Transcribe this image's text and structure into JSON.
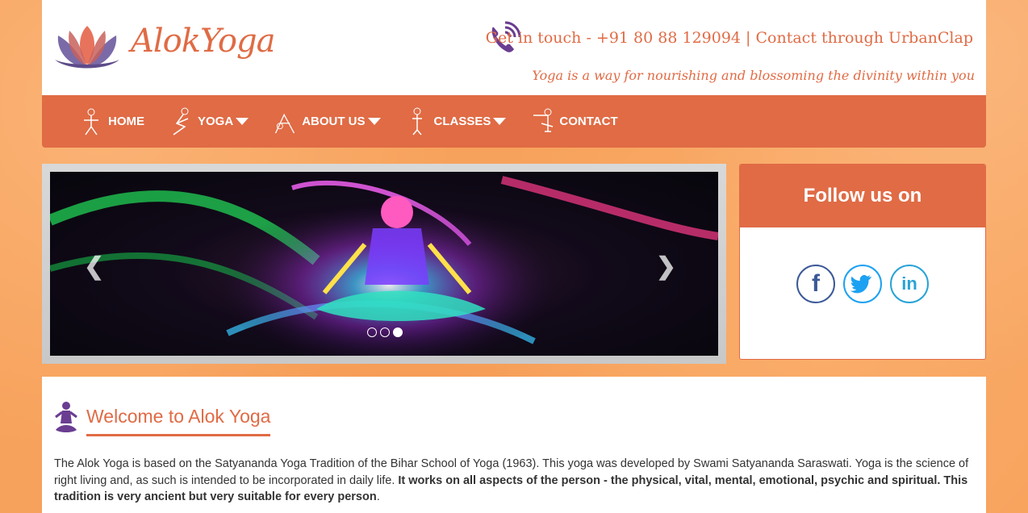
{
  "header": {
    "logo_text": "AlokYoga",
    "contact_line": "Get in touch - +91 80 88 129094 | Contact through UrbanClap",
    "tagline": "Yoga is a way for nourishing and blossoming the divinity within you"
  },
  "nav": {
    "items": [
      {
        "label": "HOME",
        "dropdown": false
      },
      {
        "label": "YOGA",
        "dropdown": true
      },
      {
        "label": "ABOUT US",
        "dropdown": true
      },
      {
        "label": "CLASSES",
        "dropdown": true
      },
      {
        "label": "CONTACT",
        "dropdown": false
      }
    ]
  },
  "slider": {
    "prev_glyph": "❮",
    "next_glyph": "❯",
    "slide_count": 3,
    "active_index": 2
  },
  "follow": {
    "title": "Follow us on",
    "networks": [
      {
        "icon": "facebook-icon",
        "glyph": "f",
        "color": "#3b5998"
      },
      {
        "icon": "twitter-icon",
        "glyph": "t",
        "color": "#1da1f2"
      },
      {
        "icon": "linkedin-icon",
        "glyph": "in",
        "color": "#29a3d6"
      }
    ]
  },
  "content": {
    "title": "Welcome to Alok Yoga",
    "intro_plain": "The Alok Yoga is based on the Satyananda Yoga Tradition of the Bihar School of Yoga (1963). This yoga was developed by Swami Satyananda Saraswati. Yoga is the science of right living and, as such is intended to be incorporated in daily life. ",
    "intro_bold": "It works on all aspects of the person - the physical, vital, mental, emotional, psychic and spiritual. This tradition is very ancient but very suitable for every person",
    "intro_end": "."
  },
  "colors": {
    "accent": "#e06b45",
    "background": "#f7a25c",
    "purple": "#6a3d91"
  }
}
